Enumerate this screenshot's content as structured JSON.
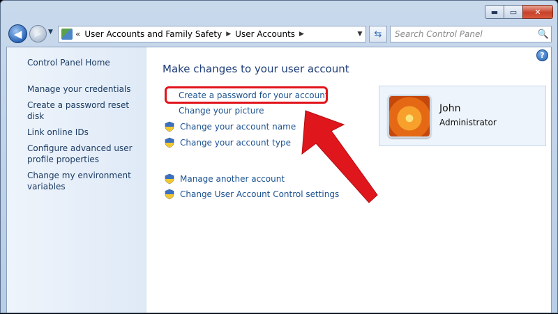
{
  "window": {
    "controls": {
      "minimize": "▬",
      "maximize": "▭",
      "close": "✕"
    }
  },
  "nav": {
    "back": "◀",
    "forward": "▶",
    "history": "▼",
    "address": {
      "icon": "control-panel-icon",
      "chevron": "«",
      "crumbs": [
        "User Accounts and Family Safety",
        "User Accounts"
      ],
      "separator": "▶",
      "dropdown": "▼"
    },
    "refresh": "⇆",
    "search": {
      "placeholder": "Search Control Panel",
      "icon": "🔍"
    }
  },
  "sidebar": {
    "home": "Control Panel Home",
    "items": [
      {
        "label": "Manage your credentials"
      },
      {
        "label": "Create a password reset disk"
      },
      {
        "label": "Link online IDs"
      },
      {
        "label": "Configure advanced user profile properties"
      },
      {
        "label": "Change my environment variables"
      }
    ]
  },
  "main": {
    "title": "Make changes to your user account",
    "help": "?",
    "tasks": [
      {
        "label": "Create a password for your account",
        "icon": ""
      },
      {
        "label": "Change your picture",
        "icon": ""
      },
      {
        "label": "Change your account name",
        "icon": "uac-shield-icon"
      },
      {
        "label": "Change your account type",
        "icon": "uac-shield-icon"
      }
    ],
    "other_tasks": [
      {
        "label": "Manage another account",
        "icon": "uac-shield-icon"
      },
      {
        "label": "Change User Account Control settings",
        "icon": "uac-shield-icon"
      }
    ]
  },
  "account": {
    "name": "John",
    "role": "Administrator"
  },
  "colors": {
    "highlight": "#e2141b",
    "link": "#1a5190",
    "title": "#1e3d78"
  }
}
